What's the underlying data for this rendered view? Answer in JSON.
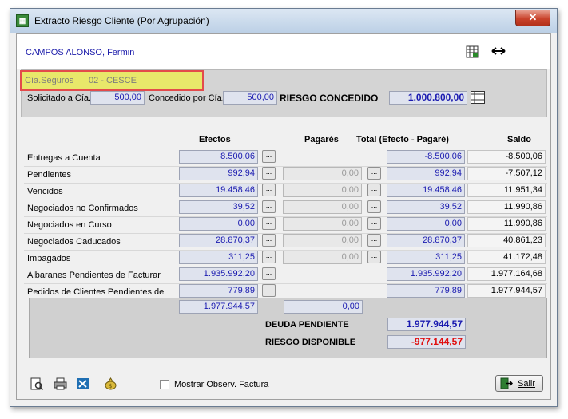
{
  "window": {
    "title": "Extracto Riesgo Cliente (Por Agrupación)",
    "close_icon": "close-icon"
  },
  "header": {
    "client_name": "CAMPOS ALONSO, Fermin"
  },
  "cia": {
    "label": "Cía.Seguros",
    "value": "02 - CESCE"
  },
  "riesgo": {
    "solicitado_label": "Solicitado a Cía.",
    "solicitado_value": "500,00",
    "concedido_label": "Concedido por Cía.",
    "concedido_value": "500,00",
    "riesgo_label": "RIESGO CONCEDIDO",
    "riesgo_value": "1.000.800,00"
  },
  "columns": {
    "efectos": "Efectos",
    "pagares": "Pagarés",
    "total": "Total (Efecto - Pagaré)",
    "saldo": "Saldo"
  },
  "rows": [
    {
      "label": "Entregas a Cuenta",
      "efectos": "8.500,06",
      "pagares": null,
      "total": "-8.500,06",
      "saldo": "-8.500,06"
    },
    {
      "label": "Pendientes",
      "efectos": "992,94",
      "pagares": "0,00",
      "total": "992,94",
      "saldo": "-7.507,12"
    },
    {
      "label": "Vencidos",
      "efectos": "19.458,46",
      "pagares": "0,00",
      "total": "19.458,46",
      "saldo": "11.951,34"
    },
    {
      "label": "Negociados no Confirmados",
      "efectos": "39,52",
      "pagares": "0,00",
      "total": "39,52",
      "saldo": "11.990,86"
    },
    {
      "label": "Negociados en Curso",
      "efectos": "0,00",
      "pagares": "0,00",
      "total": "0,00",
      "saldo": "11.990,86"
    },
    {
      "label": "Negociados Caducados",
      "efectos": "28.870,37",
      "pagares": "0,00",
      "total": "28.870,37",
      "saldo": "40.861,23"
    },
    {
      "label": "Impagados",
      "efectos": "311,25",
      "pagares": "0,00",
      "total": "311,25",
      "saldo": "41.172,48"
    },
    {
      "label": "Albaranes Pendientes de Facturar",
      "efectos": "1.935.992,20",
      "pagares": null,
      "total": "1.935.992,20",
      "saldo": "1.977.164,68"
    },
    {
      "label": "Pedidos de Clientes Pendientes de",
      "efectos": "779,89",
      "pagares": null,
      "total": "779,89",
      "saldo": "1.977.944,57"
    }
  ],
  "totals": {
    "efectos": "1.977.944,57",
    "pagares": "0,00",
    "deuda_label": "DEUDA PENDIENTE",
    "deuda_value": "1.977.944,57",
    "riesgo_disp_label": "RIESGO DISPONIBLE",
    "riesgo_disp_value": "-977.144,57"
  },
  "footer": {
    "mostrar_label": "Mostrar Observ. Factura",
    "salir_label": "Salir"
  },
  "colors": {
    "value_blue": "#1a1ab0",
    "negative_red": "#e01010",
    "highlight_yellow": "#e8e86a",
    "highlight_border": "#e34b4b"
  }
}
